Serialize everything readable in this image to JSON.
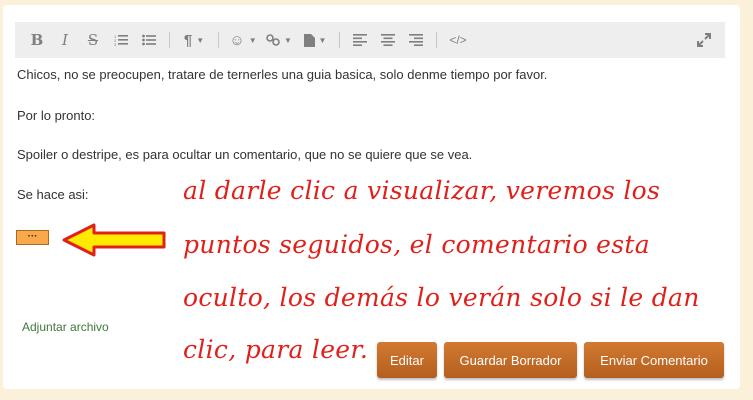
{
  "toolbar": {
    "items": [
      "bold-icon",
      "italic-icon",
      "strikethrough-icon",
      "ordered-list-icon",
      "unordered-list-icon",
      "paragraph-icon",
      "emoji-icon",
      "link-icon",
      "file-icon",
      "align-left-icon",
      "align-center-icon",
      "align-right-icon",
      "code-icon",
      "fullscreen-icon"
    ]
  },
  "editor": {
    "line1": "Chicos, no se preocupen, tratare de ternerles una guia basica, solo denme tiempo por favor.",
    "line2": "Por lo pronto:",
    "line3": "Spoiler o destripe, es para ocultar un comentario, que no se quiere que se vea.",
    "line4": "Se hace asi:",
    "spoiler_label": "···"
  },
  "annotation": {
    "line1": "al darle clic a visualizar, veremos los",
    "line2": "puntos seguidos, el comentario esta",
    "line3": "oculto, los demás lo verán solo si le dan",
    "line4": "clic, para leer."
  },
  "attach_label": "Adjuntar archivo",
  "buttons": {
    "edit": "Editar",
    "save_draft": "Guardar Borrador",
    "send": "Enviar Comentario"
  },
  "colors": {
    "page_bg": "#fbf0d9",
    "annotation": "#e0201a",
    "button": "#c46a27",
    "arrow_fill": "#ffeb00"
  }
}
